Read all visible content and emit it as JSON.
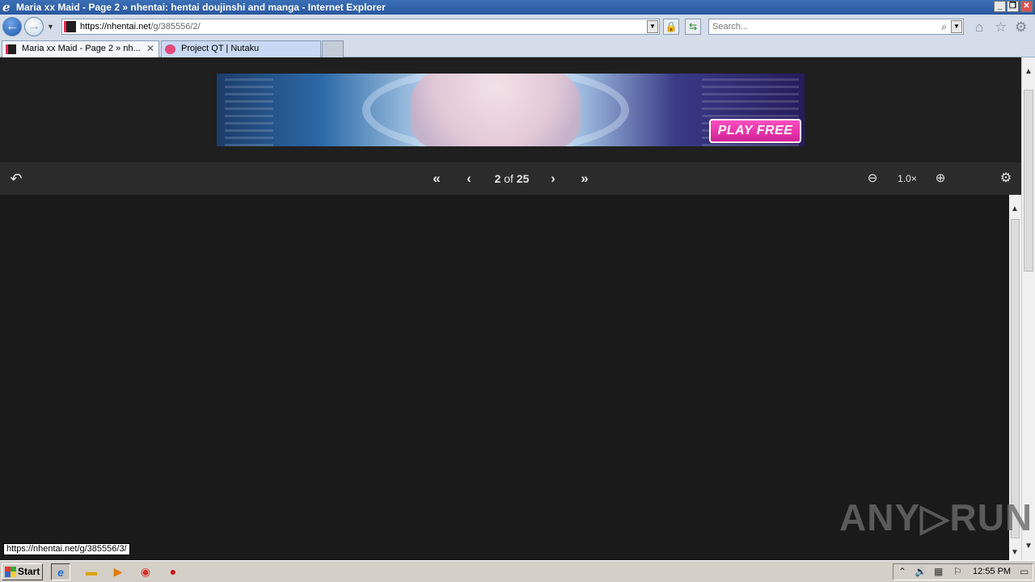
{
  "window": {
    "title": "Maria xx Maid - Page 2 » nhentai: hentai doujinshi and manga - Internet Explorer",
    "minimize": "_",
    "restore": "❐",
    "close": "✕"
  },
  "address": {
    "host": "https://nhentai.net",
    "path": "/g/385556/2/"
  },
  "search": {
    "placeholder": "Search..."
  },
  "tabs": [
    {
      "label": "Maria xx Maid - Page 2 » nh...",
      "active": true,
      "close": "✕"
    },
    {
      "label": "Project QT | Nutaku",
      "active": false
    }
  ],
  "ad": {
    "cta": "PLAY FREE"
  },
  "reader": {
    "current_page": "2",
    "of": "of",
    "total_pages": "25",
    "zoom": "1.0×",
    "icons": {
      "back": "return-arrow-icon",
      "first": "double-chevron-left-icon",
      "prev": "chevron-left-icon",
      "next": "chevron-right-icon",
      "last": "double-chevron-right-icon",
      "zoom_out": "zoom-out-icon",
      "zoom_in": "zoom-in-icon",
      "settings": "gear-icon"
    }
  },
  "status_url": "https://nhentai.net/g/385556/3/",
  "watermark": "ANY▷RUN",
  "taskbar": {
    "start": "Start",
    "clock": "12:55 PM"
  },
  "colors": {
    "page_bg": "#1f1f1f",
    "toolbar_bg": "#2b2b2b",
    "cta_pink": "#e12aa6",
    "accent_pink": "#ec2854"
  }
}
